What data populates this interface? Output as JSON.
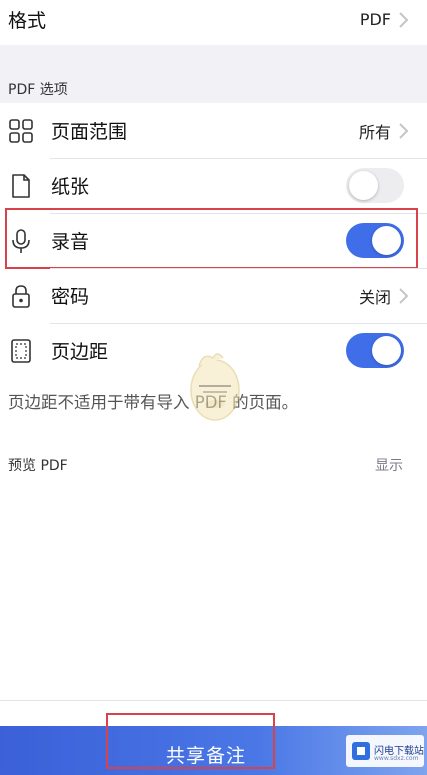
{
  "format_row": {
    "label": "格式",
    "value": "PDF"
  },
  "pdf_options_header": "PDF 选项",
  "options": {
    "page_range": {
      "label": "页面范围",
      "value": "所有"
    },
    "paper": {
      "label": "纸张",
      "toggle": "off"
    },
    "recording": {
      "label": "录音",
      "toggle": "on"
    },
    "password": {
      "label": "密码",
      "value": "关闭"
    },
    "margins": {
      "label": "页边距",
      "toggle": "on"
    }
  },
  "margins_note": "页边距不适用于带有导入 PDF 的页面。",
  "preview": {
    "title": "预览 PDF",
    "action": "显示"
  },
  "share_button": {
    "label": "共享备注"
  },
  "watermark_logo": {
    "title": "闪电下载站",
    "subtitle": "www.sdxz.com"
  },
  "colors": {
    "accent": "#3f6ee8",
    "highlight": "#d8434b",
    "background": "#f2f2f6"
  }
}
